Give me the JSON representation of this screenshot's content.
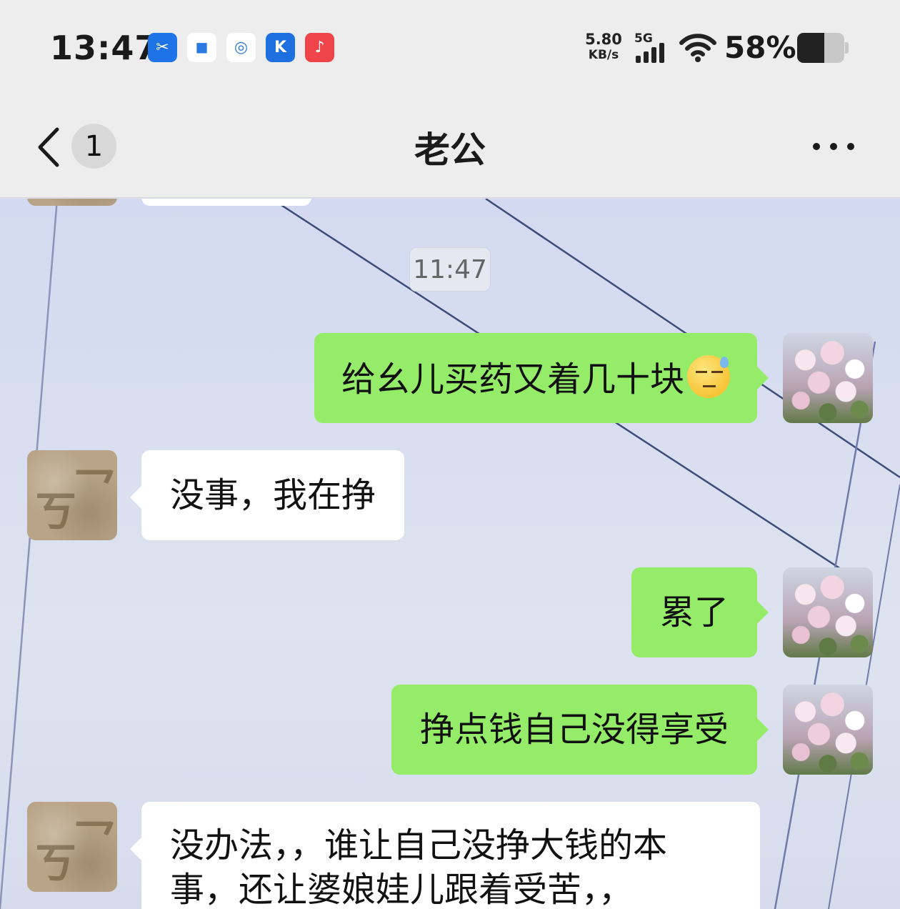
{
  "status_bar": {
    "time": "13:47",
    "app_icons": [
      {
        "name": "screenshot-app-icon",
        "glyph": "✂",
        "color": "#1e73e6"
      },
      {
        "name": "message-app-icon",
        "glyph": "◼",
        "color": "#ffffff"
      },
      {
        "name": "carrier-app-icon",
        "glyph": "◎",
        "color": "#ffffff"
      },
      {
        "name": "kugou-app-icon",
        "glyph": "K",
        "color": "#1e6fe0"
      },
      {
        "name": "music-app-icon",
        "glyph": "♪",
        "color": "#f0444b"
      }
    ],
    "network_speed": "5.80",
    "network_speed_unit": "KB/s",
    "network_type": "5G",
    "battery_percent_text": "58%",
    "battery_level": 0.58
  },
  "header": {
    "unread_count": "1",
    "title": "老公"
  },
  "chat": {
    "timestamp": "11:47",
    "messages": [
      {
        "sender": "me",
        "text": "给幺儿买药又着几十块"
      },
      {
        "sender": "other",
        "text": "没事，我在挣"
      },
      {
        "sender": "me",
        "text": "累了"
      },
      {
        "sender": "me",
        "text": "挣点钱自己没得享受"
      },
      {
        "sender": "other",
        "text": "没办法，，谁让自己没挣大钱的本事，还让婆娘娃儿跟着受苦，，"
      }
    ]
  },
  "colors": {
    "outgoing_bubble": "#95ec69",
    "incoming_bubble": "#ffffff",
    "header_bg": "#ededed"
  }
}
